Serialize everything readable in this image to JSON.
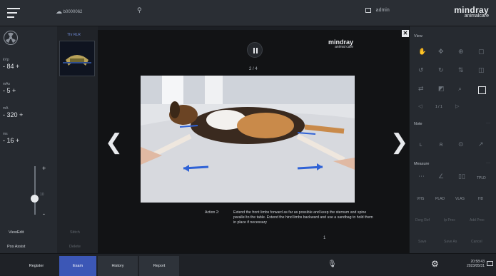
{
  "topbar": {
    "patient_id": "b0000062",
    "user": "admin",
    "brand": {
      "name": "mindray",
      "sub": "animalcare"
    }
  },
  "left": {
    "params": [
      {
        "label": "kVp",
        "value": "- 84 +"
      },
      {
        "label": "mAs",
        "value": "- 5 +"
      },
      {
        "label": "mA",
        "value": "- 320 +"
      },
      {
        "label": "ms",
        "value": "- 16 +"
      }
    ],
    "slider_value": "10",
    "thumb_title": "Thr RLR",
    "buttons": {
      "view_edit": "ViewEdit",
      "pos_assist": "Pos Assist",
      "stitch": "Stitch",
      "delete": "Delete"
    }
  },
  "viewer": {
    "page_indicator": "2 / 4",
    "brand": {
      "name": "mindray",
      "sub": "animal care"
    },
    "caption_label": "Action 2:",
    "caption_text": "Extend the front limbs forward as far as possible and keep the sternum and spine parallel to the table. Extend the hind limbs backward and use a sandbag to hold them in place if necessary",
    "page_number": "1"
  },
  "right": {
    "view_title": "View",
    "view_pager": "1 / 1",
    "note_title": "Note",
    "note_items": [
      "L",
      "R"
    ],
    "measure_title": "Measure",
    "measure_row2": [
      "VHS",
      "PLAD",
      "VLAS",
      "HD"
    ],
    "measure_tpld": "TPLD",
    "measure_row3": [
      "Dorg Ref",
      "Ip Proc",
      "Add Proc"
    ],
    "measure_row4": [
      "Save",
      "Save As",
      "Cancel"
    ]
  },
  "bottom": {
    "tabs": [
      "Register",
      "Exam",
      "History",
      "Report"
    ],
    "time": "20:58:43",
    "date": "2023/05/31"
  },
  "colors": {
    "accent": "#3c57b6",
    "panel": "#262a30",
    "viewer": "#121315"
  }
}
